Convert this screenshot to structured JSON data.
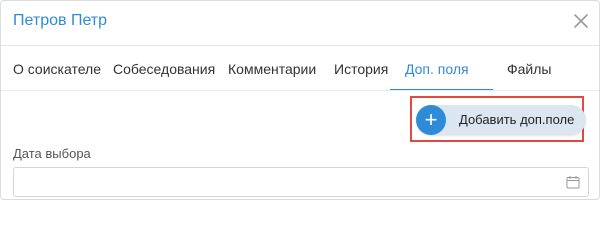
{
  "dialog": {
    "title": "Петров Петр"
  },
  "tabs": [
    {
      "label": "О соискателе",
      "active": false
    },
    {
      "label": "Собеседования",
      "active": false
    },
    {
      "label": "Комментарии",
      "active": false
    },
    {
      "label": "История",
      "active": false
    },
    {
      "label": "Доп. поля",
      "active": true
    },
    {
      "label": "Файлы",
      "active": false
    }
  ],
  "add_button": {
    "icon": "plus-icon",
    "icon_glyph": "+",
    "label": "Добавить доп.поле"
  },
  "field": {
    "label": "Дата выбора",
    "value": "",
    "icon": "calendar-icon"
  },
  "colors": {
    "accent": "#2e8bd8",
    "highlight_border": "#e5483f",
    "button_bg": "#dbe6f1"
  }
}
